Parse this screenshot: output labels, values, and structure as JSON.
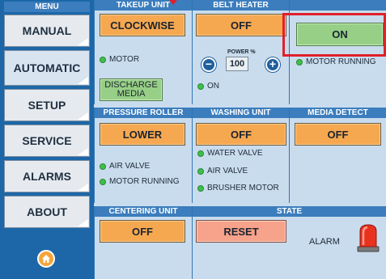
{
  "sidebar": {
    "header": "MENU",
    "items": [
      {
        "label": "MANUAL",
        "active": false
      },
      {
        "label": "AUTOMATIC",
        "active": true
      },
      {
        "label": "SETUP",
        "active": false
      },
      {
        "label": "SERVICE",
        "active": false
      },
      {
        "label": "ALARMS",
        "active": false
      },
      {
        "label": "ABOUT",
        "active": false
      }
    ],
    "home_icon": "home-icon"
  },
  "takeup_unit": {
    "title": "TAKEUP UNIT",
    "button": "CLOCKWISE",
    "status": [
      "MOTOR"
    ],
    "discharge_button_line1": "DISCHARGE",
    "discharge_button_line2": "MEDIA"
  },
  "belt_heater": {
    "title": "BELT HEATER",
    "button": "OFF",
    "power_label": "POWER %",
    "power_value": "100",
    "minus": "−",
    "plus": "+",
    "status": [
      "ON"
    ]
  },
  "top_right": {
    "button": "ON",
    "status": [
      "MOTOR RUNNING"
    ]
  },
  "pressure_roller": {
    "title": "PRESSURE ROLLER",
    "button": "LOWER",
    "status": [
      "AIR VALVE",
      "MOTOR RUNNING"
    ]
  },
  "washing_unit": {
    "title": "WASHING UNIT",
    "button": "OFF",
    "status": [
      "WATER VALVE",
      "AIR VALVE",
      "BRUSHER MOTOR"
    ]
  },
  "media_detect": {
    "title": "MEDIA DETECT",
    "button": "OFF"
  },
  "centering_unit": {
    "title": "CENTERING UNIT",
    "button": "OFF"
  },
  "state": {
    "title": "STATE",
    "reset_button": "RESET",
    "alarm_label": "ALARM",
    "alarm_icon": "alarm-beacon-icon"
  },
  "colors": {
    "sidebar": "#1d67a8",
    "header": "#3b7dbd",
    "background": "#c9dcee",
    "orange_button": "#f6a850",
    "green_button": "#97cf86",
    "reset_button": "#f7a28a",
    "status_led": "#3fbf4a",
    "highlight": "#e0202a"
  }
}
